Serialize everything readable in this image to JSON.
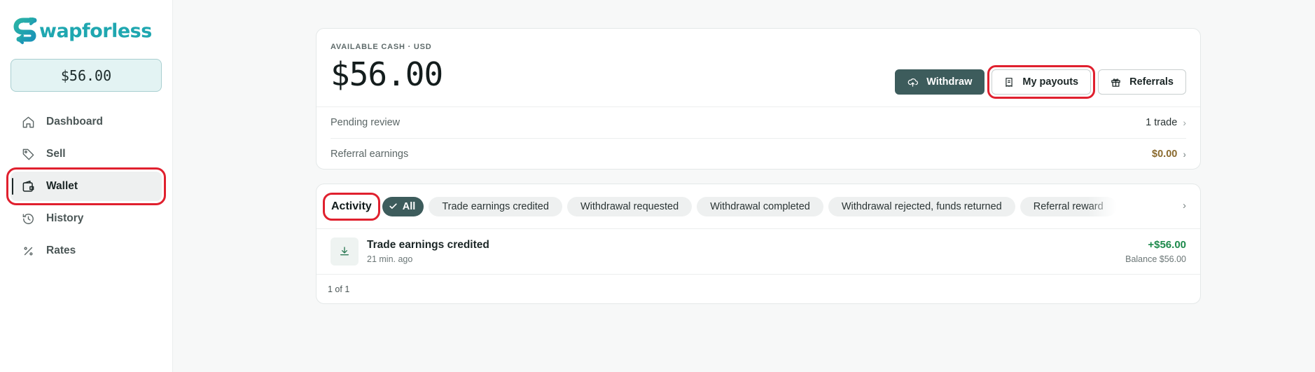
{
  "brand": {
    "logo_text": "wapforless",
    "logo_letter": "S",
    "color": "#1fa7b0"
  },
  "sidebar": {
    "balance": "$56.00",
    "items": [
      {
        "label": "Dashboard",
        "icon": "home-icon"
      },
      {
        "label": "Sell",
        "icon": "tag-icon"
      },
      {
        "label": "Wallet",
        "icon": "wallet-icon",
        "active": true
      },
      {
        "label": "History",
        "icon": "history-icon"
      },
      {
        "label": "Rates",
        "icon": "percent-icon"
      }
    ]
  },
  "wallet": {
    "cash_label": "AVAILABLE CASH · USD",
    "cash_amount": "$56.00",
    "actions": {
      "withdraw": "Withdraw",
      "payouts": "My payouts",
      "referrals": "Referrals"
    },
    "rows": [
      {
        "label": "Pending review",
        "value": "1 trade"
      },
      {
        "label": "Referral earnings",
        "value": "$0.00"
      }
    ]
  },
  "activity": {
    "title": "Activity",
    "filters": [
      "All",
      "Trade earnings credited",
      "Withdrawal requested",
      "Withdrawal completed",
      "Withdrawal rejected, funds returned",
      "Referral reward"
    ],
    "transactions": [
      {
        "title": "Trade earnings credited",
        "time": "21 min. ago",
        "amount": "+$56.00",
        "balance": "Balance $56.00"
      }
    ],
    "pager": "1 of 1"
  },
  "colors": {
    "accent": "#3d5c5c",
    "highlight": "#e0202e",
    "positive": "#1e8a4c",
    "gold": "#8a6a2e"
  }
}
